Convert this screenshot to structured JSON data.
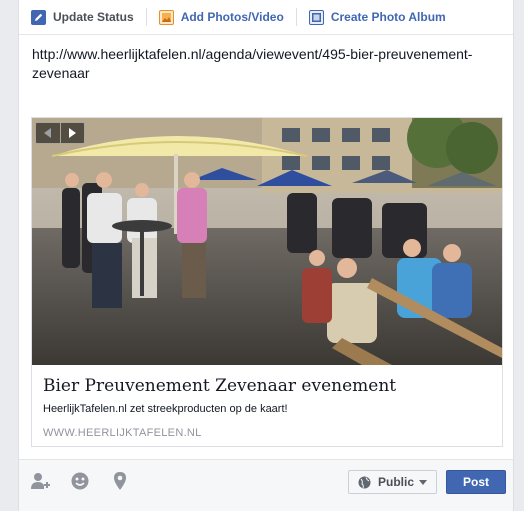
{
  "tabs": {
    "update_status": "Update Status",
    "add_photos": "Add Photos/Video",
    "create_album": "Create Photo Album"
  },
  "status_text": "http://www.heerlijktafelen.nl/agenda/viewevent/495-bier-preuvenement-zevenaar",
  "link_preview": {
    "title": "Bier Preuvenement Zevenaar evenement",
    "description": "HeerlijkTafelen.nl zet streekproducten op de kaart!",
    "domain": "WWW.HEERLIJKTAFELEN.NL",
    "image_icon": "festival-crowd-photo"
  },
  "footer": {
    "tag_icon": "tag-friends-icon",
    "feeling_icon": "smiley-icon",
    "location_icon": "location-pin-icon",
    "audience_label": "Public",
    "post_label": "Post"
  },
  "colors": {
    "accent": "#4267b2",
    "footer_bg": "#f6f7f9",
    "muted": "#90949c"
  }
}
